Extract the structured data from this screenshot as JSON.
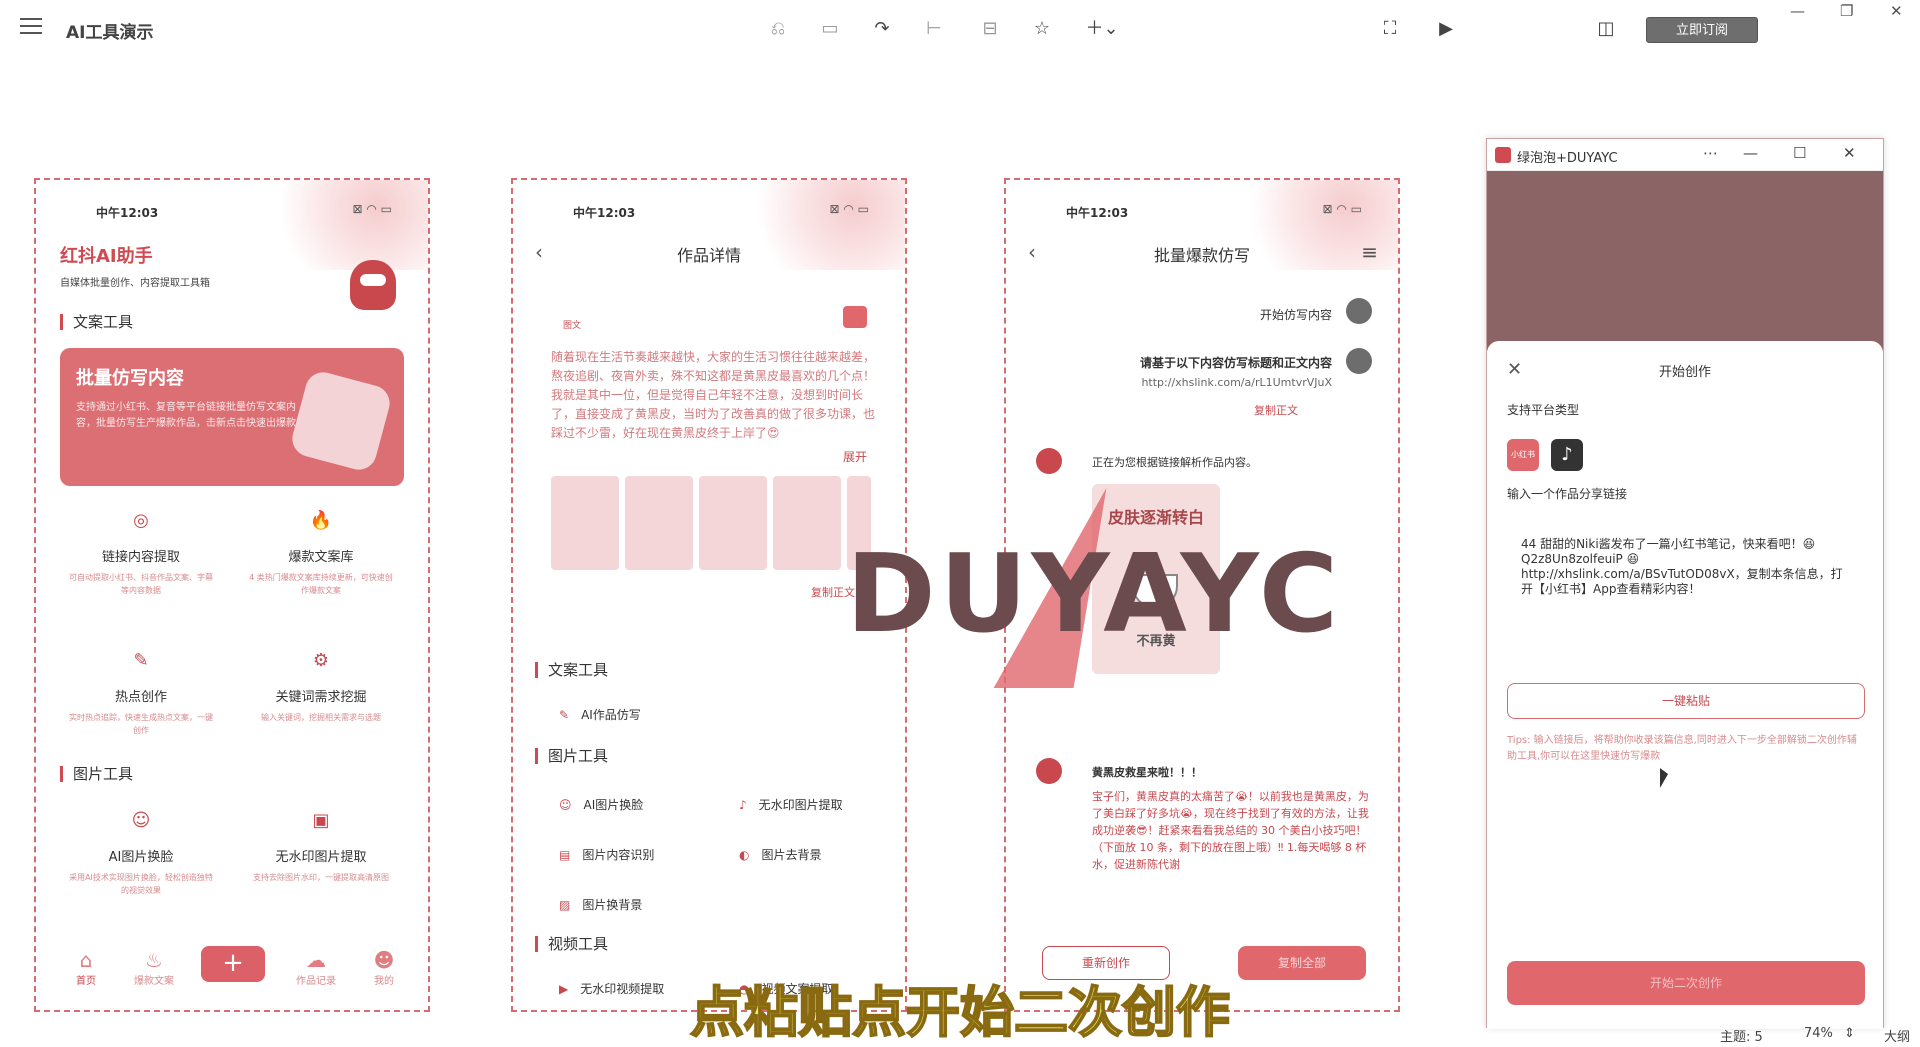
{
  "toolbar": {
    "app_title": "AI工具演示",
    "subscribe_label": "立即订阅"
  },
  "phone1": {
    "time": "中午12:03",
    "brand": "红抖AI助手",
    "brand_sub": "自媒体批量创作、内容提取工具箱",
    "sec_copy": "文案工具",
    "card_title": "批量仿写内容",
    "card_desc": "支持通过小红书、复音等平台链接批量仿写文案内容，批量仿写生产爆款作品，击新点击快速出爆款",
    "tools": [
      {
        "name": "链接内容提取",
        "desc": "可自动提取小红书、抖音作品文案、字幕等内容数据"
      },
      {
        "name": "爆款文案库",
        "desc": "4 类热门爆款文案库持续更新，可快速创作爆款文案"
      },
      {
        "name": "热点创作",
        "desc": "实时热点追踪，快速生成热点文案，一键创作"
      },
      {
        "name": "关键词需求挖掘",
        "desc": "输入关键词，挖掘相关需求与选题"
      }
    ],
    "sec_image": "图片工具",
    "img_tools": [
      {
        "name": "AI图片换脸",
        "desc": "采用AI技术实现图片换脸，轻松创造独特的视觉效果"
      },
      {
        "name": "无水印图片提取",
        "desc": "支持去除图片水印，一键提取高清原图"
      }
    ],
    "tabs": [
      "首页",
      "爆款文案",
      "",
      "作品记录",
      "我的"
    ]
  },
  "phone2": {
    "time": "中午12:03",
    "title": "作品详情",
    "tag": "图文",
    "article": "随着现在生活节奏越来越快，大家的生活习惯往往越来越差，熬夜追剧、夜宵外卖，殊不知这都是黄黑皮最喜欢的几个点！我就是其中一位，但是觉得自己年轻不注意，没想到时间长了，直接变成了黄黑皮，当时为了改善真的做了很多功课，也踩过不少雷，好在现在黄黑皮终于上岸了😍",
    "expand": "展开",
    "copy_body": "复制正文",
    "sec_copy": "文案工具",
    "ai_rewrite": "AI作品仿写",
    "sec_image": "图片工具",
    "img_items": [
      "AI图片换脸",
      "无水印图片提取",
      "图片内容识别",
      "图片去背景",
      "图片换背景"
    ],
    "sec_video": "视频工具",
    "video_items": [
      "无水印视频提取",
      "视频文案提取"
    ]
  },
  "phone3": {
    "time": "中午12:03",
    "title": "批量爆款仿写",
    "msg_start": "开始仿写内容",
    "msg_request": "请基于以下内容仿写标题和正文内容",
    "msg_link": "http://xhslink.com/a/rL1UmtvrVJuX",
    "msg_copy": "复制正文",
    "bot_parsing": "正在为您根据链接解析作品内容。",
    "card_title": "皮肤逐渐转白",
    "card_bottom": "不再黄",
    "reply_title": "黄黑皮救星来啦！！！",
    "reply_body": "宝子们，黄黑皮真的太痛苦了😭！以前我也是黄黑皮，为了美白踩了好多坑😭，现在终于找到了有效的方法，让我成功逆袭😎！赶紧来看看我总结的 30 个美白小技巧吧！（下面放 10 条，剩下的放在图上哦）‼ 1.每天喝够 8 杯水，促进新陈代谢",
    "btn_rewrite": "重新创作",
    "btn_copy": "复制全部"
  },
  "window": {
    "title": "绿泡泡+DUYAYC",
    "sheet_title": "开始创作",
    "platform_label": "支持平台类型",
    "platform_xhs": "小红书",
    "input_label": "输入一个作品分享链接",
    "share_text": "44 甜甜的Niki酱发布了一篇小红书笔记，快来看吧！😆 Q2z8Un8zolfeuiP 😆 http://xhslink.com/a/BSvTutOD08vX，复制本条信息，打开【小红书】App查看精彩内容！",
    "paste_label": "一键粘贴",
    "tips": "Tips: 输入链接后，将帮助你收录该篇信息,同时进入下一步全部解锁二次创作辅助工具,你可以在这里快速仿写爆款",
    "create_label": "开始二次创作"
  },
  "overlay": {
    "watermark": "DUYAYC",
    "subtitle": "点粘贴点开始二次创作"
  },
  "statusbar": {
    "theme": "主题: 5",
    "zoom": "74%",
    "outline": "大纲"
  }
}
